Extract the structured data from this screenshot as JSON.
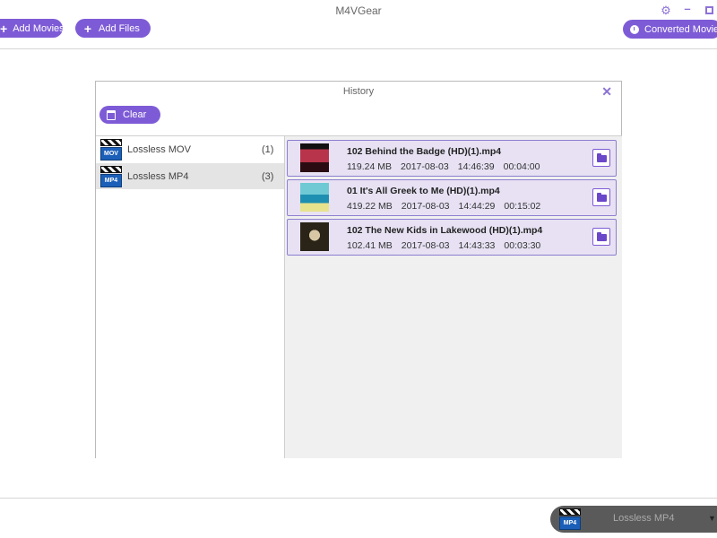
{
  "app": {
    "title": "M4VGear"
  },
  "toolbar": {
    "add_movies": "Add Movies",
    "add_files": "Add Files",
    "converted_movies": "Converted Movies",
    "add_movies_icon": "plus-icon",
    "add_files_icon": "plus-icon",
    "converted_icon": "clock-icon"
  },
  "window_controls": [
    "gear-icon",
    "minimize-icon",
    "maximize-icon"
  ],
  "dialog": {
    "title": "History",
    "close_glyph": "✕",
    "clear_label": "Clear",
    "formats": [
      {
        "tag": "MOV",
        "name": "Lossless MOV",
        "count": "(1)",
        "selected": false
      },
      {
        "tag": "MP4",
        "name": "Lossless MP4",
        "count": "(3)",
        "selected": true
      }
    ],
    "files": [
      {
        "name": "102 Behind the Badge (HD)(1).mp4",
        "size": "119.24 MB",
        "date": "2017-08-03",
        "time": "14:46:39",
        "duration": "00:04:00"
      },
      {
        "name": "01 It's All Greek to Me (HD)(1).mp4",
        "size": "419.22 MB",
        "date": "2017-08-03",
        "time": "14:44:29",
        "duration": "00:15:02"
      },
      {
        "name": "102 The New Kids in Lakewood (HD)(1).mp4",
        "size": "102.41 MB",
        "date": "2017-08-03",
        "time": "14:43:33",
        "duration": "00:03:30"
      }
    ]
  },
  "output": {
    "tag": "MP4",
    "label": "Lossless MP4",
    "caret": "▼"
  },
  "colors": {
    "accent": "#7e5bd6",
    "card_bg": "#e7e1f3",
    "card_border": "#8d7fd0"
  }
}
